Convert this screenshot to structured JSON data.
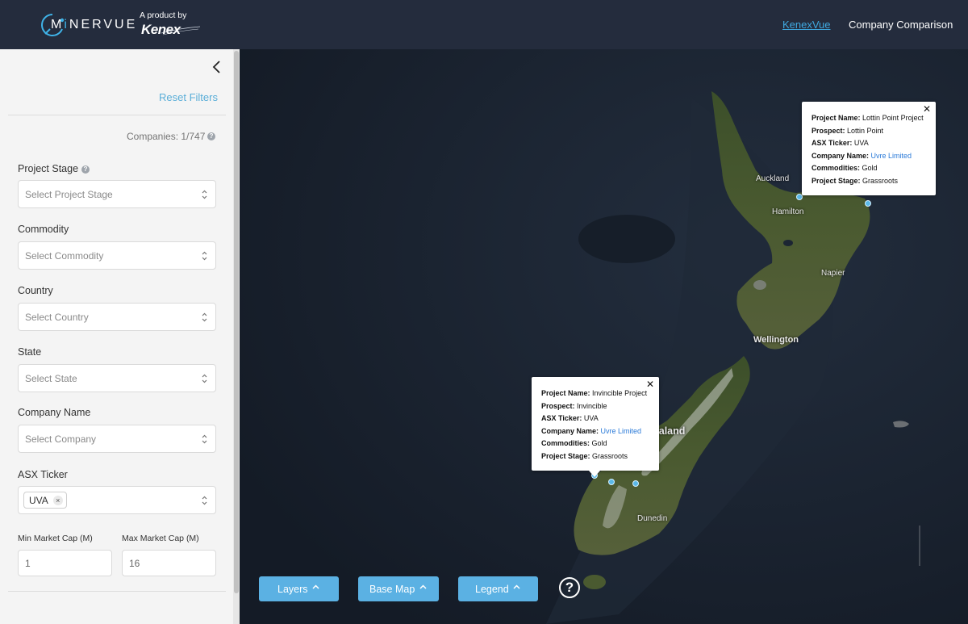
{
  "header": {
    "logo_prefix": "M",
    "logo_i": "i",
    "logo_rest": "NERVUE",
    "product_by": "A product by",
    "kenex": "Kenex",
    "nav": {
      "kenexvue": "KenexVue",
      "company_comparison": "Company Comparison"
    }
  },
  "sidebar": {
    "reset_filters": "Reset Filters",
    "companies_count": "Companies: 1/747",
    "help_glyph": "?",
    "filters": {
      "project_stage": {
        "label": "Project Stage",
        "placeholder": "Select Project Stage"
      },
      "commodity": {
        "label": "Commodity",
        "placeholder": "Select Commodity"
      },
      "country": {
        "label": "Country",
        "placeholder": "Select Country"
      },
      "state": {
        "label": "State",
        "placeholder": "Select State"
      },
      "company_name": {
        "label": "Company Name",
        "placeholder": "Select Company"
      },
      "asx_ticker": {
        "label": "ASX Ticker",
        "selected": "UVA",
        "remove": "×"
      }
    },
    "market_cap": {
      "min_label": "Min Market Cap (M)",
      "min_value": "1",
      "max_label": "Max Market Cap (M)",
      "max_value": "16"
    }
  },
  "map": {
    "place_labels": {
      "auckland": "Auckland",
      "hamilton": "Hamilton",
      "napier": "Napier",
      "wellington": "Wellington",
      "new_zealand": "New Zealand",
      "dunedin": "Dunedin"
    },
    "popups": [
      {
        "project_name_label": "Project Name:",
        "project_name": "Lottin Point Project",
        "prospect_label": "Prospect:",
        "prospect": "Lottin Point",
        "asx_ticker_label": "ASX Ticker:",
        "asx_ticker": "UVA",
        "company_name_label": "Company Name:",
        "company_name": "Uvre Limited",
        "commodities_label": "Commodities:",
        "commodities": "Gold",
        "project_stage_label": "Project Stage:",
        "project_stage": "Grassroots",
        "close": "✕"
      },
      {
        "project_name_label": "Project Name:",
        "project_name": "Invincible Project",
        "prospect_label": "Prospect:",
        "prospect": "Invincible",
        "asx_ticker_label": "ASX Ticker:",
        "asx_ticker": "UVA",
        "company_name_label": "Company Name:",
        "company_name": "Uvre Limited",
        "commodities_label": "Commodities:",
        "commodities": "Gold",
        "project_stage_label": "Project Stage:",
        "project_stage": "Grassroots",
        "close": "✕"
      }
    ],
    "controls": {
      "layers": "Layers",
      "base_map": "Base Map",
      "legend": "Legend",
      "help": "?"
    }
  },
  "colors": {
    "header_bg": "#242c3d",
    "accent": "#3fb3e8",
    "button_blue": "#5bb1e3",
    "sidebar_bg": "#f4f4f4",
    "link_blue": "#2a7ad8"
  },
  "icons": [
    "logo-ring-icon",
    "chevron-left-icon",
    "help-icon",
    "up-down-arrows-icon",
    "remove-tag-icon",
    "close-icon",
    "chevron-up-icon",
    "question-circle-icon",
    "map-marker-icon"
  ]
}
